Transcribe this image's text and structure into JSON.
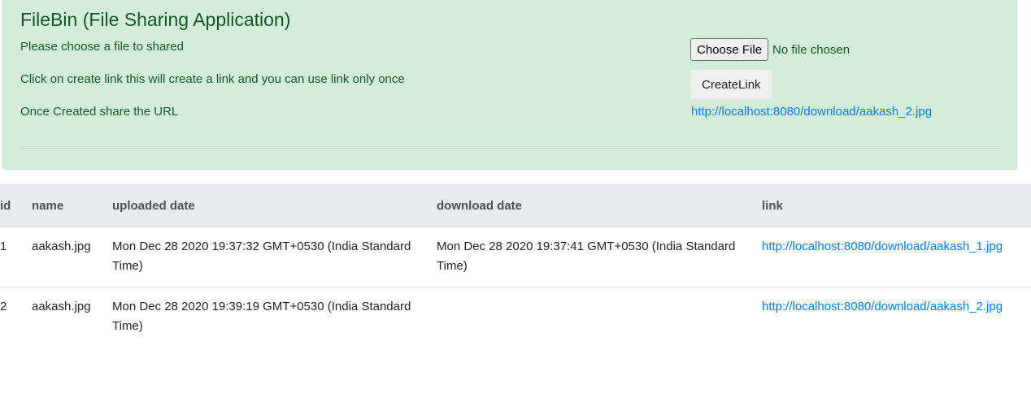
{
  "header": {
    "title": "FileBin (File Sharing Application)",
    "instructions": [
      "Please choose a file to shared",
      "Click on create link this will create a link and you can use link only once",
      "Once Created share the URL"
    ]
  },
  "upload": {
    "choose_file_label": "Choose File",
    "no_file_text": "No file chosen",
    "create_link_label": "CreateLink",
    "created_url": "http://localhost:8080/download/aakash_2.jpg"
  },
  "table": {
    "columns": [
      "id",
      "name",
      "uploaded date",
      "download date",
      "link"
    ],
    "rows": [
      {
        "id": "1",
        "name": "aakash.jpg",
        "uploaded_date": "Mon Dec 28 2020 19:37:32 GMT+0530 (India Standard Time)",
        "download_date": "Mon Dec 28 2020 19:37:41 GMT+0530 (India Standard Time)",
        "link": "http://localhost:8080/download/aakash_1.jpg"
      },
      {
        "id": "2",
        "name": "aakash.jpg",
        "uploaded_date": "Mon Dec 28 2020 19:39:19 GMT+0530 (India Standard Time)",
        "download_date": "",
        "link": "http://localhost:8080/download/aakash_2.jpg"
      }
    ]
  },
  "colors": {
    "alert_background": "#d4edda",
    "alert_text": "#155724",
    "link": "#007bff",
    "table_header_background": "#e9ecef"
  }
}
